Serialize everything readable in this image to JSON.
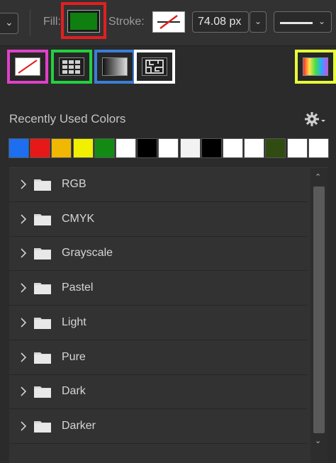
{
  "toolbar": {
    "fill_label": "Fill:",
    "fill_color": "#0f7f0f",
    "stroke_label": "Stroke:",
    "stroke_width": "74.08 px",
    "chevron": "⌄"
  },
  "fill_types": [
    {
      "name": "No Color",
      "icon": "no-color-icon",
      "highlight": "#e040c8"
    },
    {
      "name": "Solid Color",
      "icon": "solid-color-grid-icon",
      "highlight": "#22d040"
    },
    {
      "name": "Gradient",
      "icon": "gradient-icon",
      "highlight": "#3a7ed8"
    },
    {
      "name": "Pattern",
      "icon": "pattern-icon",
      "highlight": "#ffffff"
    },
    {
      "name": "Color Picker",
      "icon": "color-picker-icon",
      "highlight": "#e8ff3a"
    }
  ],
  "recent": {
    "title": "Recently Used Colors",
    "swatches": [
      "#1e6ef0",
      "#e81818",
      "#f0b800",
      "#f0f000",
      "#138a13",
      "#ffffff",
      "#000000",
      "#ffffff",
      "#f2f2f2",
      "#000000",
      "#ffffff",
      "#ffffff",
      "#304c10",
      "#ffffff",
      "#ffffff"
    ]
  },
  "groups": [
    "RGB",
    "CMYK",
    "Grayscale",
    "Pastel",
    "Light",
    "Pure",
    "Dark",
    "Darker"
  ]
}
